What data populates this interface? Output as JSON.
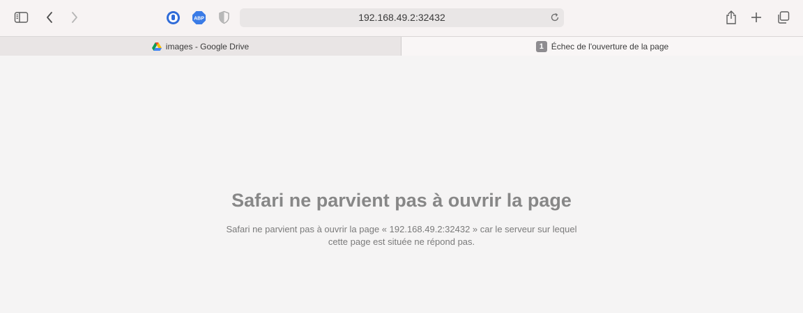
{
  "toolbar": {
    "address": "192.168.49.2:32432",
    "icons": [
      "sidebar-icon",
      "back-icon",
      "forward-icon",
      "privacy-blocker-icon",
      "adblock-plus-icon",
      "shield-icon",
      "reload-icon",
      "share-icon",
      "plus-icon",
      "tabs-overview-icon"
    ]
  },
  "tabs": [
    {
      "label": "images - Google Drive",
      "icon": "google-drive-icon"
    },
    {
      "badge": "1",
      "label": "Échec de l'ouverture de la page"
    }
  ],
  "error": {
    "title": "Safari ne parvient pas à ouvrir la page",
    "message": "Safari ne parvient pas à ouvrir la page « 192.168.49.2:32432 » car le serveur sur lequel cette page est située ne répond pas."
  },
  "colors": {
    "background": "#f5f4f4",
    "toolbar": "#f7f3f3",
    "blocker_blue": "#2f6bd8",
    "abp_blue": "#3a7be6",
    "title_gray": "#878787"
  }
}
